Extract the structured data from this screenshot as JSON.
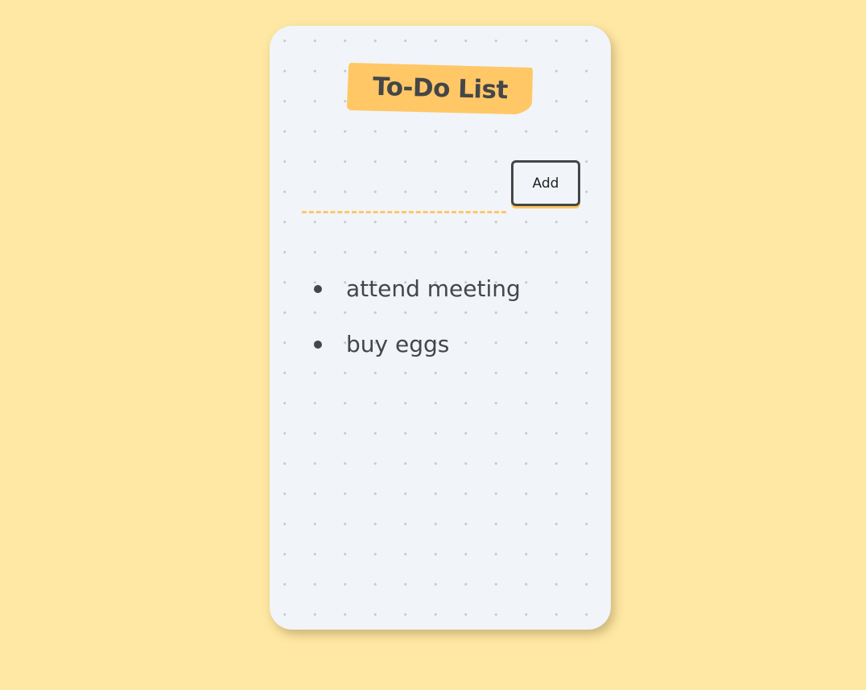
{
  "app": {
    "title": "To-Do List"
  },
  "form": {
    "input_value": "",
    "input_placeholder": "",
    "add_label": "Add"
  },
  "todos": [
    {
      "text": "attend meeting"
    },
    {
      "text": "buy eggs"
    }
  ],
  "colors": {
    "background": "#ffe8a3",
    "card": "#f1f4f8",
    "accent": "#ffc766",
    "text": "#444648",
    "dots": "#c6c9ce"
  },
  "icons": {
    "bullet": "bullet-dot-icon"
  }
}
